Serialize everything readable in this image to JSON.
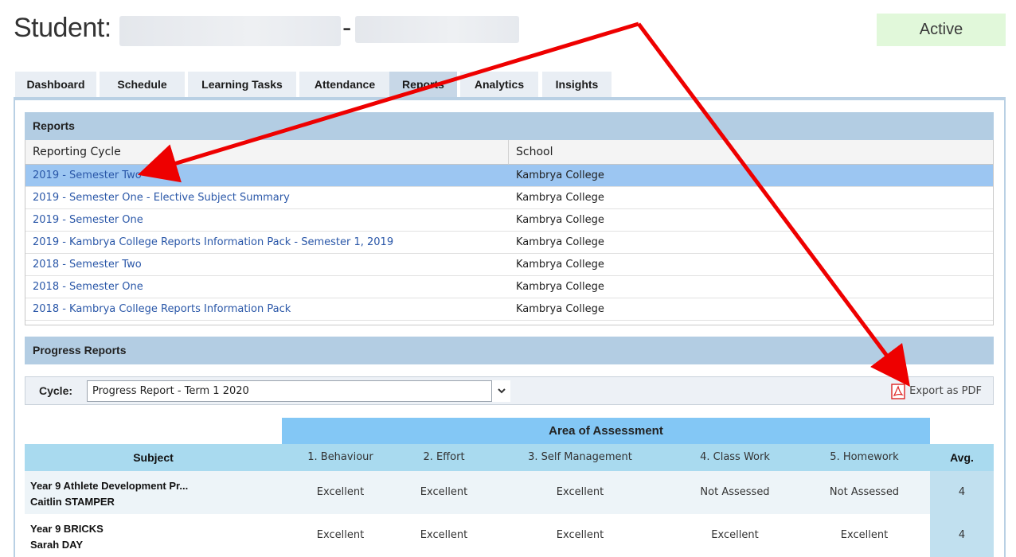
{
  "header": {
    "title_prefix": "Student:",
    "separator": "-",
    "status": "Active"
  },
  "tabs": [
    {
      "label": "Dashboard"
    },
    {
      "label": "Schedule"
    },
    {
      "label": "Learning Tasks"
    },
    {
      "label": "Attendance"
    },
    {
      "label": "Reports",
      "active": true
    },
    {
      "label": "Analytics"
    },
    {
      "label": "Insights"
    }
  ],
  "reports": {
    "section_title": "Reports",
    "columns": [
      "Reporting Cycle",
      "School"
    ],
    "rows": [
      {
        "cycle": "2019 - Semester Two",
        "school": "Kambrya College",
        "selected": true
      },
      {
        "cycle": "2019 - Semester One - Elective Subject Summary",
        "school": "Kambrya College"
      },
      {
        "cycle": "2019 - Semester One",
        "school": "Kambrya College"
      },
      {
        "cycle": "2019 - Kambrya College Reports Information Pack - Semester 1, 2019",
        "school": "Kambrya College"
      },
      {
        "cycle": "2018 - Semester Two",
        "school": "Kambrya College"
      },
      {
        "cycle": "2018 - Semester One",
        "school": "Kambrya College"
      },
      {
        "cycle": "2018 - Kambrya College Reports Information Pack",
        "school": "Kambrya College"
      }
    ]
  },
  "progress": {
    "section_title": "Progress Reports",
    "cycle_label": "Cycle:",
    "cycle_value": "Progress Report - Term 1 2020",
    "export_label": "Export as PDF",
    "area_header": "Area of Assessment",
    "columns": {
      "subject": "Subject",
      "behaviour": "1. Behaviour",
      "effort": "2. Effort",
      "self_management": "3. Self Management",
      "class_work": "4. Class Work",
      "homework": "5. Homework",
      "avg": "Avg."
    },
    "rows": [
      {
        "subject": "Year 9 Athlete Development Pr...",
        "teacher": "Caitlin STAMPER",
        "behaviour": "Excellent",
        "effort": "Excellent",
        "self_management": "Excellent",
        "class_work": "Not Assessed",
        "homework": "Not Assessed",
        "avg": "4"
      },
      {
        "subject": "Year 9 BRICKS",
        "teacher": "Sarah DAY",
        "behaviour": "Excellent",
        "effort": "Excellent",
        "self_management": "Excellent",
        "class_work": "Excellent",
        "homework": "Excellent",
        "avg": "4"
      }
    ]
  },
  "colors": {
    "selected_row": "#9cc6f2",
    "section_header": "#b3cde3",
    "assessment_header": "#83c7f5",
    "link": "#2a57a8",
    "annotation_arrow": "#ee0000",
    "status_bg": "#e1f8da"
  }
}
